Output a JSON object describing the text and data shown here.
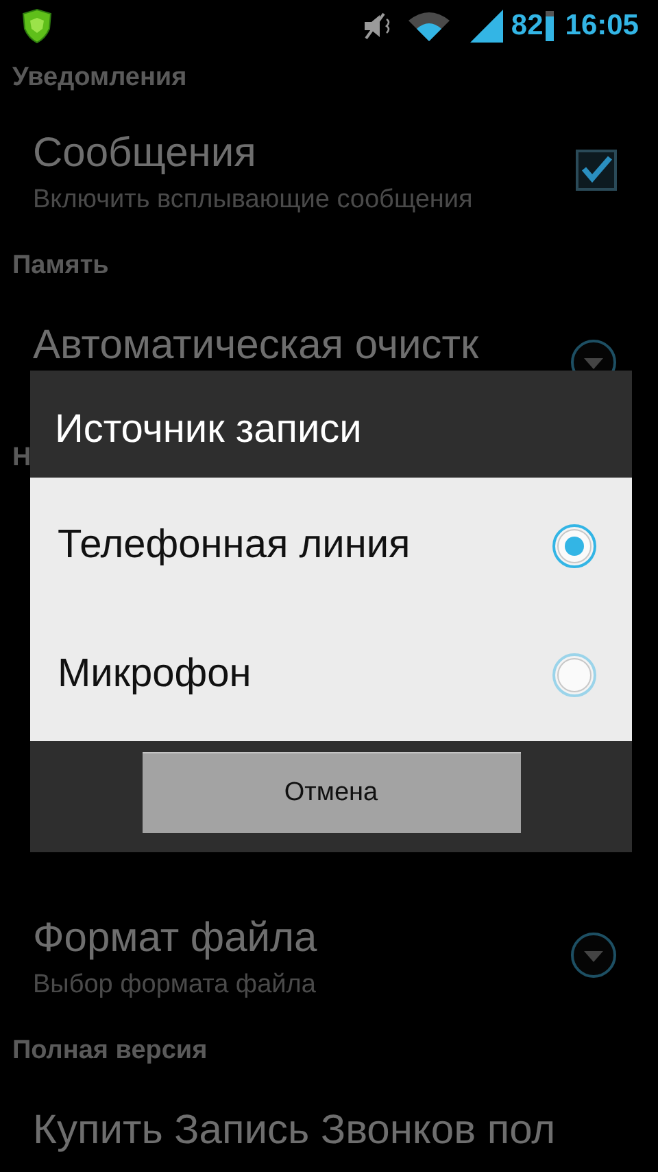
{
  "status_bar": {
    "battery_text": "82",
    "time": "16:05"
  },
  "settings": [
    {
      "kind": "header",
      "text": "Уведомления"
    },
    {
      "kind": "checkbox",
      "title": "Сообщения",
      "subtitle": "Включить всплывающие сообщения",
      "checked": true
    },
    {
      "kind": "header",
      "text": "Память"
    },
    {
      "kind": "dropdown",
      "title": "Автоматическая очистк"
    },
    {
      "kind": "header",
      "text": "Н"
    },
    {
      "kind": "dropdown",
      "title": "Формат файла",
      "subtitle": "Выбор формата файла"
    },
    {
      "kind": "header",
      "text": "Полная версия"
    },
    {
      "kind": "plain",
      "title": "Купить Запись Звонков пол"
    }
  ],
  "dialog": {
    "title": "Источник записи",
    "options": [
      {
        "label": "Телефонная линия",
        "selected": true
      },
      {
        "label": "Микрофон",
        "selected": false
      }
    ],
    "buttons": [
      "Отмена"
    ]
  }
}
